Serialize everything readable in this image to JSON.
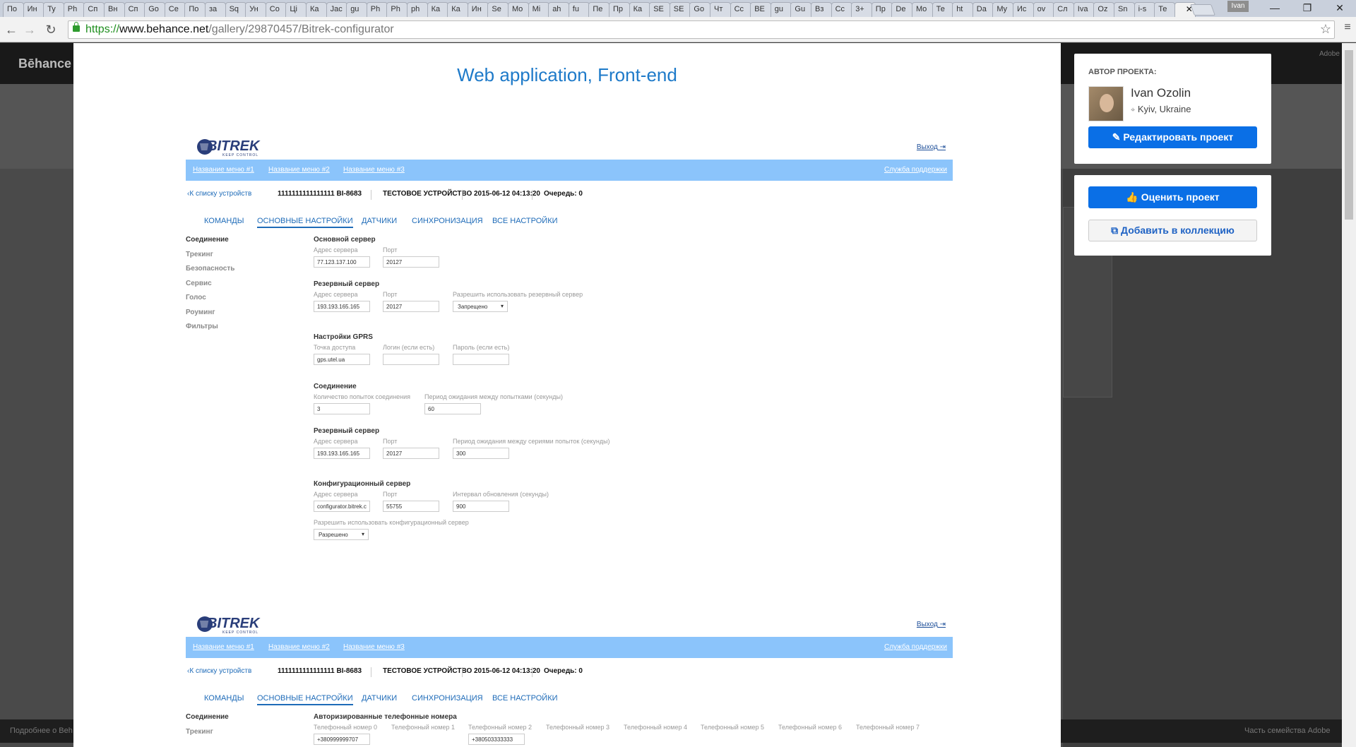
{
  "browser": {
    "tabs": [
      "По",
      "Ин",
      "Ту",
      "Ph",
      "Сп",
      "Вн",
      "Сп",
      "Go",
      "Се",
      "По",
      "за",
      "Sq",
      "Ун",
      "Со",
      "Ці",
      "Ка",
      "Jac",
      "gu",
      "Ph",
      "Ph",
      "ph",
      "Ка",
      "Ка",
      "Ин",
      "Se",
      "Mo",
      "Mi",
      "ah",
      "fu",
      "Пе",
      "Пр",
      "Ка",
      "SE",
      "SE",
      "Go",
      "Чт",
      "Сс",
      "BE",
      "gu",
      "Gu",
      "Вз",
      "Сс",
      "3+",
      "Пр",
      "De",
      "Mo",
      "Те",
      "ht",
      "Da",
      "My",
      "Ис",
      "ov",
      "Сл",
      "Iva",
      "Oz",
      "Sn",
      "i-s",
      "Те",
      ""
    ],
    "active_tab_index": 58,
    "profile": "Ivan",
    "url_scheme": "https://",
    "url_host": "www.behance.net",
    "url_path": "/gallery/29870457/Bitrek-configurator"
  },
  "behance": {
    "logo": "Bēhance",
    "footer_left": "Подробнее о Beh",
    "footer_right": "Часть семейства Adobe",
    "adobe_label": "Adobe"
  },
  "project": {
    "title": "Web application, Front-end"
  },
  "app": {
    "logo_text": "BITREK",
    "logo_tagline": "KEEP CONTROL",
    "logout": "Выход",
    "menu": [
      "Название меню #1",
      "Название меню #2",
      "Название меню #3"
    ],
    "support": "Служба поддержки",
    "back": "К списку устройств",
    "device_id": "1111111111111111 BI-8683",
    "device_name": "ТЕСТОВОЕ УСТРОЙСТВО",
    "datetime": "2015-06-12 04:13:20",
    "queue": "Очередь: 0",
    "tabs": [
      "КОМАНДЫ",
      "ОСНОВНЫЕ НАСТРОЙКИ",
      "ДАТЧИКИ",
      "СИНХРОНИЗАЦИЯ",
      "ВСЕ НАСТРОЙКИ"
    ],
    "side": [
      "Соединение",
      "Трекинг",
      "Безопасность",
      "Сервис",
      "Голос",
      "Роуминг",
      "Фильтры"
    ],
    "form": {
      "main_server": "Основной сервер",
      "addr_label": "Адрес сервера",
      "port_label": "Порт",
      "main_addr": "77.123.137.100",
      "main_port": "20127",
      "reserve_server": "Резервный сервер",
      "reserve_addr": "193.193.165.165",
      "reserve_port": "20127",
      "allow_reserve_label": "Разрешить использовать резервный сервер",
      "allow_reserve_value": "Запрещено",
      "gprs": "Настройки GPRS",
      "apn_label": "Точка доступа",
      "apn_value": "gps.utel.ua",
      "login_label": "Логин (если есть)",
      "pass_label": "Пароль (если есть)",
      "connection": "Соединение",
      "attempts_label": "Количество попыток соединения",
      "attempts_value": "3",
      "wait_label": "Период ожидания между попытками (секунды)",
      "wait_value": "60",
      "reserve2": "Резервный сервер",
      "reserve2_addr": "193.193.165.165",
      "reserve2_port": "20127",
      "series_label": "Период ожидания между сериями попыток (секунды)",
      "series_value": "300",
      "config_server": "Конфигурационный сервер",
      "config_addr": "configurator.bitrek.c",
      "config_port": "55755",
      "refresh_label": "Интервал обновления (секунды)",
      "refresh_value": "900",
      "allow_config_label": "Разрешить использовать конфигурационный сервер",
      "allow_config_value": "Разрешено"
    },
    "phones_title": "Авторизированные телефонные номера",
    "phone_labels": [
      "Телефонный номер 0",
      "Телефонный номер 1",
      "Телефонный номер 2",
      "Телефонный номер 3",
      "Телефонный номер 4",
      "Телефонный номер 5",
      "Телефонный номер 6",
      "Телефонный номер 7"
    ],
    "phone0": "+380999999707",
    "phone2": "+380503333333"
  },
  "sidebar": {
    "author_heading": "АВТОР ПРОЕКТА:",
    "author_name": "Ivan Ozolin",
    "author_location": "Kyiv, Ukraine",
    "edit_button": "Редактировать проект",
    "rate_button": "Оценить проект",
    "collect_button": "Добавить в коллекцию"
  }
}
